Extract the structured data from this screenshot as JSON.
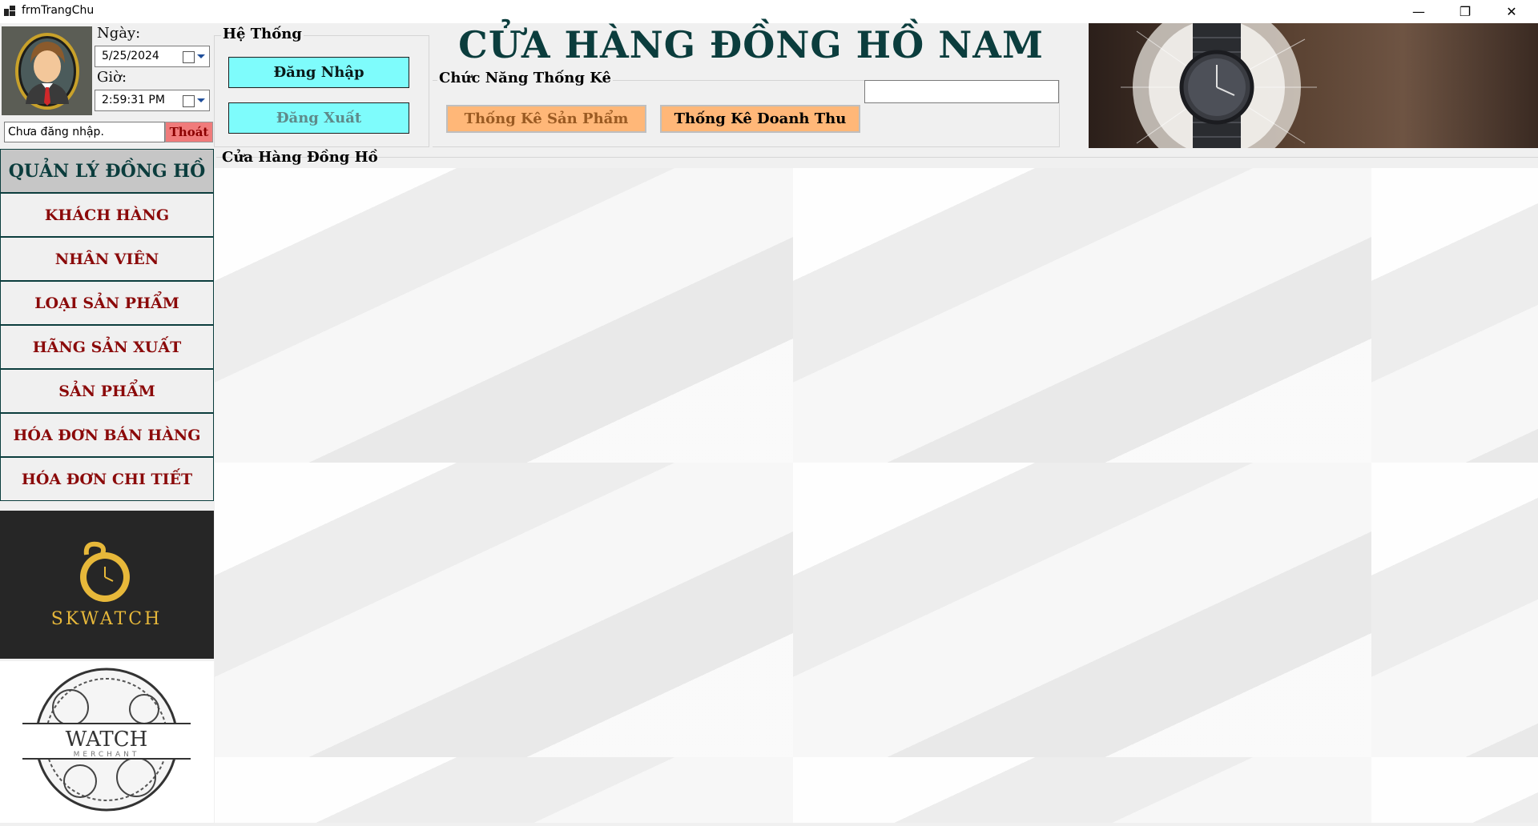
{
  "window": {
    "title": "frmTrangChu",
    "controls": {
      "minimize": "—",
      "restore": "❐",
      "close": "✕"
    }
  },
  "header": {
    "date_label": "Ngày:",
    "date_value": "5/25/2024",
    "time_label": "Giờ:",
    "time_value": "2:59:31 PM",
    "login_status": "Chưa đăng nhập.",
    "exit_label": "Thoát",
    "store_title": "CỬA HÀNG ĐỒNG HỒ NAM"
  },
  "system_group": {
    "title": "Hệ Thống",
    "login_label": "Đăng Nhập",
    "logout_label": "Đăng Xuất"
  },
  "stats_group": {
    "title": "Chức Năng Thống Kê",
    "product_stats_label": "Thống Kê Sản Phẩm",
    "revenue_stats_label": "Thống Kê Doanh Thu",
    "search_value": ""
  },
  "sidebar": {
    "header": "QUẢN LÝ ĐỒNG HỒ",
    "items": [
      {
        "label": "KHÁCH HÀNG"
      },
      {
        "label": "NHÂN VIÊN"
      },
      {
        "label": "LOẠI SẢN PHẨM"
      },
      {
        "label": "HÃNG SẢN XUẤT"
      },
      {
        "label": "SẢN PHẨM"
      },
      {
        "label": "HÓA ĐƠN BÁN HÀNG"
      },
      {
        "label": "HÓA ĐƠN CHI TIẾT"
      }
    ],
    "brand_logo_text": "SKWATCH",
    "merchant_logo_text": "WATCH",
    "merchant_logo_subtext": "MERCHANT"
  },
  "main": {
    "title": "Cửa Hàng Đồng Hồ"
  },
  "colors": {
    "accent_dark": "#0b3d3d",
    "nav_text": "#8b0a0a",
    "cyan_button": "#7efcfc",
    "orange_button": "#ffb778",
    "exit_button": "#f07b7b"
  },
  "icons": {
    "app": "app-icon",
    "calendar": "calendar-icon",
    "dropdown": "chevron-down-icon"
  }
}
